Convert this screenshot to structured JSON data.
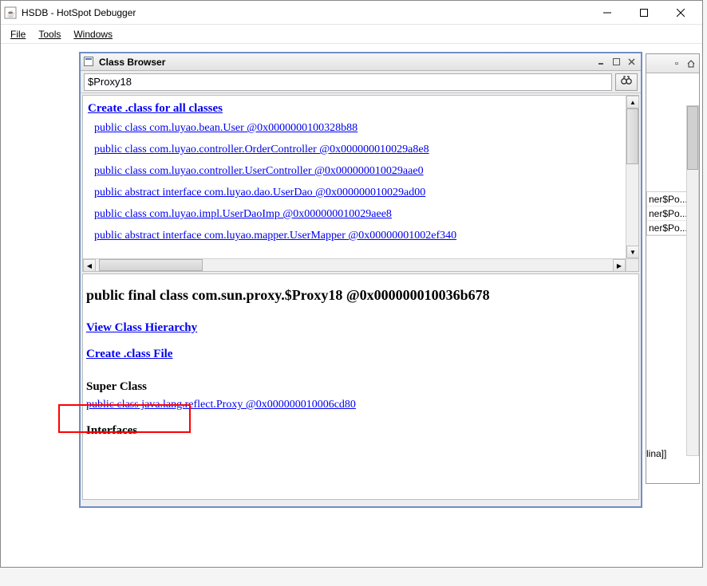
{
  "window": {
    "title": "HSDB - HotSpot Debugger"
  },
  "menu": {
    "file": "File",
    "tools": "Tools",
    "windows": "Windows"
  },
  "class_browser": {
    "title": "Class Browser",
    "search_value": "$Proxy18",
    "create_all_label": "Create .class for all classes",
    "class_list": [
      "public class com.luyao.bean.User @0x0000000100328b88",
      "public class com.luyao.controller.OrderController @0x000000010029a8e8",
      "public class com.luyao.controller.UserController @0x000000010029aae0",
      "public abstract interface com.luyao.dao.UserDao @0x000000010029ad00",
      "public class com.luyao.impl.UserDaoImp @0x000000010029aee8",
      "public abstract interface com.luyao.mapper.UserMapper @0x00000001002ef340"
    ]
  },
  "detail": {
    "heading": "public final class com.sun.proxy.$Proxy18 @0x000000010036b678",
    "view_hierarchy": "View Class Hierarchy",
    "create_class_file": "Create .class File",
    "super_class_label": "Super Class",
    "super_class_link": "public class java.lang.reflect.Proxy @0x000000010006cd80",
    "interfaces_label": "Interfaces"
  },
  "bg_window": {
    "rows": [
      "ner$Po...",
      "ner$Po...",
      "ner$Po..."
    ],
    "bottom": "lina]]"
  }
}
